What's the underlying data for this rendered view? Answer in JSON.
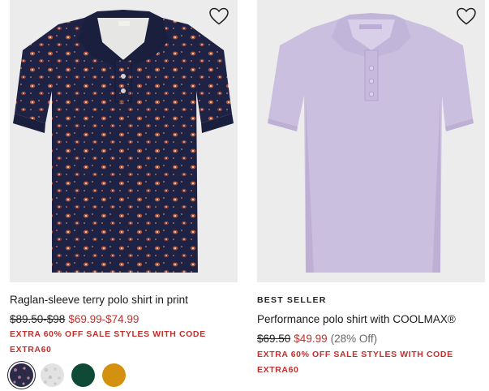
{
  "products": [
    {
      "name": "Raglan-sleeve terry polo shirt in print",
      "original_price": "$89.50-$98",
      "sale_price": "$69.99-$74.99",
      "promo_line1": "EXTRA 60% OFF SALE STYLES WITH CODE",
      "promo_line2": "EXTRA60",
      "image": "navy paisley print polo shirt",
      "swatches": [
        {
          "name": "navy print",
          "color": "#2b2a48",
          "selected": true
        },
        {
          "name": "white print",
          "color": "#e2e2e2",
          "selected": false
        },
        {
          "name": "green",
          "color": "#0f4a37",
          "selected": false
        },
        {
          "name": "gold",
          "color": "#d4900f",
          "selected": false
        }
      ]
    },
    {
      "badge": "BEST SELLER",
      "name": "Performance polo shirt with COOLMAX®",
      "original_price": "$69.50",
      "sale_price": "$49.99",
      "discount": "(28% Off)",
      "promo_line1": "EXTRA 60% OFF SALE STYLES WITH CODE",
      "promo_line2": "EXTRA60",
      "image": "lavender polo shirt"
    }
  ],
  "icons": {
    "wishlist": "heart-icon"
  },
  "colors": {
    "sale_red": "#c4302b",
    "image_bg": "#ececec",
    "navy": "#1e2244",
    "lavender": "#cbbfe0"
  }
}
